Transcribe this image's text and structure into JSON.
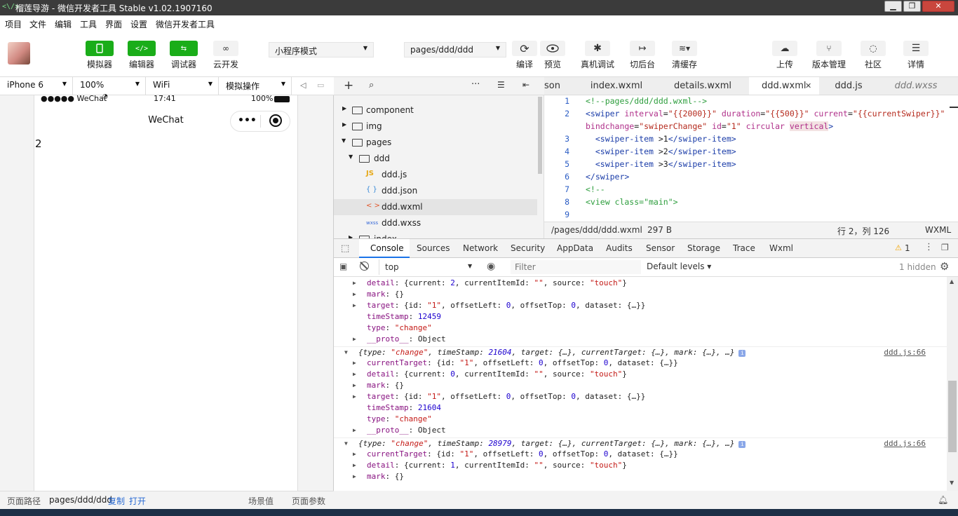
{
  "window": {
    "title": "榴莲导游 - 微信开发者工具 Stable v1.02.1907160",
    "app_icon": "<\\/>",
    "min": "▁",
    "max": "❐",
    "close": "✕"
  },
  "menu": [
    "项目",
    "文件",
    "编辑",
    "工具",
    "界面",
    "设置",
    "微信开发者工具"
  ],
  "toolbar": {
    "left_buttons": [
      {
        "label": "模拟器",
        "icon": "phone-icon"
      },
      {
        "label": "编辑器",
        "icon": "code-icon"
      },
      {
        "label": "调试器",
        "icon": "debug-icon"
      },
      {
        "label": "云开发",
        "icon": "cloud-link-icon"
      }
    ],
    "mode_select": "小程序模式",
    "page_select": "pages/ddd/ddd",
    "mid_buttons": [
      {
        "label": "编译",
        "icon": "refresh-icon"
      },
      {
        "label": "预览",
        "icon": "eye-icon"
      },
      {
        "label": "真机调试",
        "icon": "bug-icon"
      },
      {
        "label": "切后台",
        "icon": "switch-icon"
      },
      {
        "label": "清缓存",
        "icon": "layers-icon"
      }
    ],
    "right_buttons": [
      {
        "label": "上传",
        "icon": "upload-icon"
      },
      {
        "label": "版本管理",
        "icon": "branch-icon"
      },
      {
        "label": "社区",
        "icon": "chat-icon"
      },
      {
        "label": "详情",
        "icon": "menu-icon"
      }
    ]
  },
  "simulator": {
    "device": "iPhone 6",
    "zoom": "100%",
    "network": "WiFi",
    "operation": "模拟操作",
    "status_carrier": "●●●●● WeChat",
    "status_time": "17:41",
    "status_battery": "100%",
    "nav_title": "WeChat",
    "capsule_dots": "•••",
    "capsule_circle": "⦿",
    "content_text": "2"
  },
  "bottom_status": {
    "path_label": "页面路径",
    "path": "pages/ddd/ddd",
    "copy": "复制",
    "open": "打开",
    "scene": "场景值",
    "params": "页面参数"
  },
  "file_tree": [
    {
      "name": "component",
      "type": "folder",
      "open": false,
      "depth": 0
    },
    {
      "name": "img",
      "type": "folder",
      "open": false,
      "depth": 0
    },
    {
      "name": "pages",
      "type": "folder",
      "open": true,
      "depth": 0
    },
    {
      "name": "ddd",
      "type": "folder",
      "open": true,
      "depth": 1
    },
    {
      "name": "ddd.js",
      "type": "js",
      "icon": "JS",
      "depth": 2
    },
    {
      "name": "ddd.json",
      "type": "json",
      "icon": "{ }",
      "depth": 2
    },
    {
      "name": "ddd.wxml",
      "type": "wxml",
      "icon": "< >",
      "depth": 2,
      "selected": true
    },
    {
      "name": "ddd.wxss",
      "type": "wxss",
      "icon": "wxss",
      "depth": 2
    },
    {
      "name": "index",
      "type": "folder",
      "open": false,
      "depth": 1
    }
  ],
  "editor_tabs": [
    {
      "label": "son"
    },
    {
      "label": "index.wxml"
    },
    {
      "label": "details.wxml"
    },
    {
      "label": "ddd.wxml",
      "active": true,
      "close": "✕"
    },
    {
      "label": "ddd.js"
    },
    {
      "label": "ddd.wxss",
      "italic": true
    }
  ],
  "code_lines": [
    {
      "n": "1",
      "parts": [
        [
          "c-cm",
          "<!--pages/ddd/ddd.wxml-->"
        ]
      ]
    },
    {
      "n": "2",
      "parts": [
        [
          "c-tg",
          "<swiper "
        ],
        [
          "c-at",
          "interval"
        ],
        [
          "c-tx",
          "="
        ],
        [
          "c-str",
          "\"{{2000}}\""
        ],
        [
          "c-tx",
          " "
        ],
        [
          "c-at",
          "duration"
        ],
        [
          "c-tx",
          "="
        ],
        [
          "c-str",
          "\"{{500}}\""
        ],
        [
          "c-tx",
          " "
        ],
        [
          "c-at",
          "current"
        ],
        [
          "c-tx",
          "="
        ],
        [
          "c-str",
          "\"{{currentSwiper}}\""
        ]
      ]
    },
    {
      "n": "",
      "parts": [
        [
          "c-at",
          "bindchange"
        ],
        [
          "c-tx",
          "="
        ],
        [
          "c-str",
          "\"swiperChange\""
        ],
        [
          "c-tx",
          " "
        ],
        [
          "c-at",
          "id"
        ],
        [
          "c-tx",
          "="
        ],
        [
          "c-str",
          "\"1\""
        ],
        [
          "c-tx",
          " "
        ],
        [
          "c-at",
          "circular"
        ],
        [
          "c-tx",
          " "
        ],
        [
          "c-at",
          "vertical"
        ],
        [
          "c-tg",
          ">"
        ]
      ]
    },
    {
      "n": "3",
      "parts": [
        [
          "c-tx",
          "  "
        ],
        [
          "c-tg",
          "<swiper-item "
        ],
        [
          "c-tx",
          ">1"
        ],
        [
          "c-tg",
          "</swiper-item>"
        ]
      ]
    },
    {
      "n": "4",
      "parts": [
        [
          "c-tx",
          "  "
        ],
        [
          "c-tg",
          "<swiper-item "
        ],
        [
          "c-tx",
          ">2"
        ],
        [
          "c-tg",
          "</swiper-item>"
        ]
      ]
    },
    {
      "n": "5",
      "parts": [
        [
          "c-tx",
          "  "
        ],
        [
          "c-tg",
          "<swiper-item "
        ],
        [
          "c-tx",
          ">3"
        ],
        [
          "c-tg",
          "</swiper-item>"
        ]
      ]
    },
    {
      "n": "6",
      "parts": [
        [
          "c-tg",
          "</swiper>"
        ]
      ]
    },
    {
      "n": "7",
      "parts": [
        [
          "c-cm",
          "<!--"
        ]
      ]
    },
    {
      "n": "8",
      "parts": [
        [
          "c-cm",
          "<view class=\"main\">"
        ]
      ]
    },
    {
      "n": "9",
      "parts": []
    }
  ],
  "editor_status": {
    "path": "/pages/ddd/ddd.wxml",
    "size": "297 B",
    "position": "行 2，列 126",
    "lang": "WXML"
  },
  "devtools_tabs": [
    "Console",
    "Sources",
    "Network",
    "Security",
    "AppData",
    "Audits",
    "Sensor",
    "Storage",
    "Trace",
    "Wxml"
  ],
  "devtools_active": "Console",
  "warning_count": "1",
  "console_toolbar": {
    "context": "top",
    "filter_placeholder": "Filter",
    "levels": "Default levels",
    "hidden": "1 hidden"
  },
  "console_rows": [
    {
      "indent": 1,
      "caret": "▶",
      "html": [
        [
          "k",
          "detail"
        ],
        [
          "o",
          ": {current: "
        ],
        [
          "n",
          "2"
        ],
        [
          "o",
          ", currentItemId: "
        ],
        [
          "s",
          "\"\""
        ],
        [
          "o",
          ", source: "
        ],
        [
          "s",
          "\"touch\""
        ],
        [
          "o",
          "}"
        ]
      ]
    },
    {
      "indent": 1,
      "caret": "▶",
      "html": [
        [
          "k",
          "mark"
        ],
        [
          "o",
          ": {}"
        ]
      ]
    },
    {
      "indent": 1,
      "caret": "▶",
      "html": [
        [
          "k",
          "target"
        ],
        [
          "o",
          ": {id: "
        ],
        [
          "s",
          "\"1\""
        ],
        [
          "o",
          ", offsetLeft: "
        ],
        [
          "n",
          "0"
        ],
        [
          "o",
          ", offsetTop: "
        ],
        [
          "n",
          "0"
        ],
        [
          "o",
          ", dataset: {…}}"
        ]
      ]
    },
    {
      "indent": 1,
      "caret": "",
      "html": [
        [
          "k",
          "timeStamp"
        ],
        [
          "o",
          ": "
        ],
        [
          "n",
          "12459"
        ]
      ]
    },
    {
      "indent": 1,
      "caret": "",
      "html": [
        [
          "k",
          "type"
        ],
        [
          "o",
          ": "
        ],
        [
          "s",
          "\"change\""
        ]
      ]
    },
    {
      "indent": 1,
      "caret": "▶",
      "html": [
        [
          "k",
          "__proto__"
        ],
        [
          "o",
          ": Object"
        ]
      ]
    },
    {
      "indent": 0,
      "caret": "▼",
      "head": true,
      "src": "ddd.js:66",
      "html": [
        [
          "o",
          "{type: "
        ],
        [
          "s",
          "\"change\""
        ],
        [
          "o",
          ", timeStamp: "
        ],
        [
          "n",
          "21604"
        ],
        [
          "o",
          ", target: {…}, currentTarget: {…}, mark: {…}, …}"
        ]
      ]
    },
    {
      "indent": 1,
      "caret": "▶",
      "html": [
        [
          "k",
          "currentTarget"
        ],
        [
          "o",
          ": {id: "
        ],
        [
          "s",
          "\"1\""
        ],
        [
          "o",
          ", offsetLeft: "
        ],
        [
          "n",
          "0"
        ],
        [
          "o",
          ", offsetTop: "
        ],
        [
          "n",
          "0"
        ],
        [
          "o",
          ", dataset: {…}}"
        ]
      ]
    },
    {
      "indent": 1,
      "caret": "▶",
      "html": [
        [
          "k",
          "detail"
        ],
        [
          "o",
          ": {current: "
        ],
        [
          "n",
          "0"
        ],
        [
          "o",
          ", currentItemId: "
        ],
        [
          "s",
          "\"\""
        ],
        [
          "o",
          ", source: "
        ],
        [
          "s",
          "\"touch\""
        ],
        [
          "o",
          "}"
        ]
      ]
    },
    {
      "indent": 1,
      "caret": "▶",
      "html": [
        [
          "k",
          "mark"
        ],
        [
          "o",
          ": {}"
        ]
      ]
    },
    {
      "indent": 1,
      "caret": "▶",
      "html": [
        [
          "k",
          "target"
        ],
        [
          "o",
          ": {id: "
        ],
        [
          "s",
          "\"1\""
        ],
        [
          "o",
          ", offsetLeft: "
        ],
        [
          "n",
          "0"
        ],
        [
          "o",
          ", offsetTop: "
        ],
        [
          "n",
          "0"
        ],
        [
          "o",
          ", dataset: {…}}"
        ]
      ]
    },
    {
      "indent": 1,
      "caret": "",
      "html": [
        [
          "k",
          "timeStamp"
        ],
        [
          "o",
          ": "
        ],
        [
          "n",
          "21604"
        ]
      ]
    },
    {
      "indent": 1,
      "caret": "",
      "html": [
        [
          "k",
          "type"
        ],
        [
          "o",
          ": "
        ],
        [
          "s",
          "\"change\""
        ]
      ]
    },
    {
      "indent": 1,
      "caret": "▶",
      "html": [
        [
          "k",
          "__proto__"
        ],
        [
          "o",
          ": Object"
        ]
      ]
    },
    {
      "indent": 0,
      "caret": "▼",
      "head": true,
      "src": "ddd.js:66",
      "html": [
        [
          "o",
          "{type: "
        ],
        [
          "s",
          "\"change\""
        ],
        [
          "o",
          ", timeStamp: "
        ],
        [
          "n",
          "28979"
        ],
        [
          "o",
          ", target: {…}, currentTarget: {…}, mark: {…}, …}"
        ]
      ]
    },
    {
      "indent": 1,
      "caret": "▶",
      "html": [
        [
          "k",
          "currentTarget"
        ],
        [
          "o",
          ": {id: "
        ],
        [
          "s",
          "\"1\""
        ],
        [
          "o",
          ", offsetLeft: "
        ],
        [
          "n",
          "0"
        ],
        [
          "o",
          ", offsetTop: "
        ],
        [
          "n",
          "0"
        ],
        [
          "o",
          ", dataset: {…}}"
        ]
      ]
    },
    {
      "indent": 1,
      "caret": "▶",
      "html": [
        [
          "k",
          "detail"
        ],
        [
          "o",
          ": {current: "
        ],
        [
          "n",
          "1"
        ],
        [
          "o",
          ", currentItemId: "
        ],
        [
          "s",
          "\"\""
        ],
        [
          "o",
          ", source: "
        ],
        [
          "s",
          "\"touch\""
        ],
        [
          "o",
          "}"
        ]
      ]
    },
    {
      "indent": 1,
      "caret": "▶",
      "html": [
        [
          "k",
          "mark"
        ],
        [
          "o",
          ": {}"
        ]
      ]
    }
  ],
  "colors": {
    "accent_green": "#1aad19",
    "title_bar": "#3b3b3b",
    "link_blue": "#2a6bd4"
  }
}
